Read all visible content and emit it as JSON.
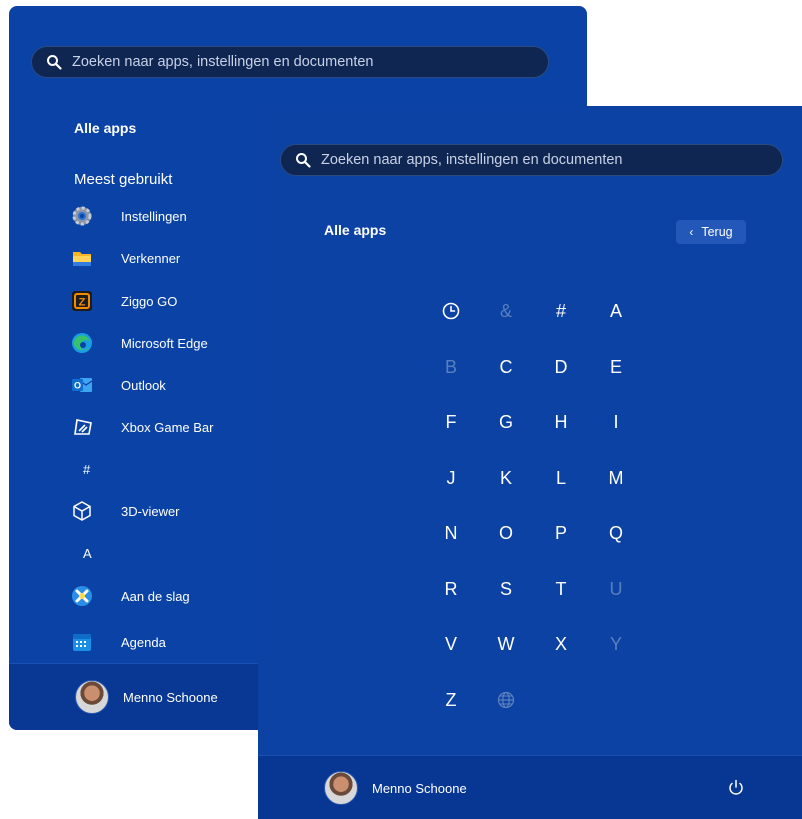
{
  "back_panel": {
    "search_placeholder": "Zoeken naar apps, instellingen en documenten",
    "title": "Alle apps",
    "most_used_title": "Meest gebruikt",
    "apps": [
      {
        "label": "Instellingen",
        "icon": "gear-icon"
      },
      {
        "label": "Verkenner",
        "icon": "folder-icon"
      },
      {
        "label": "Ziggo GO",
        "icon": "ziggo-icon"
      },
      {
        "label": "Microsoft Edge",
        "icon": "edge-icon"
      },
      {
        "label": "Outlook",
        "icon": "outlook-icon"
      },
      {
        "label": "Xbox Game Bar",
        "icon": "xbox-game-bar-icon"
      }
    ],
    "hash_header": "#",
    "apps_hash": [
      {
        "label": "3D-viewer",
        "icon": "cube-icon"
      }
    ],
    "a_header": "A",
    "apps_a": [
      {
        "label": "Aan de slag",
        "icon": "getting-started-icon"
      },
      {
        "label": "Agenda",
        "icon": "calendar-icon"
      }
    ],
    "user_name": "Menno Schoone"
  },
  "front_panel": {
    "search_placeholder": "Zoeken naar apps, instellingen en documenten",
    "title": "Alle apps",
    "back_label": "Terug",
    "letters": [
      {
        "label": "clock",
        "enabled": true,
        "icon": "clock-icon"
      },
      {
        "label": "&",
        "enabled": false
      },
      {
        "label": "#",
        "enabled": true
      },
      {
        "label": "A",
        "enabled": true
      },
      {
        "label": "B",
        "enabled": false
      },
      {
        "label": "C",
        "enabled": true
      },
      {
        "label": "D",
        "enabled": true
      },
      {
        "label": "E",
        "enabled": true
      },
      {
        "label": "F",
        "enabled": true
      },
      {
        "label": "G",
        "enabled": true
      },
      {
        "label": "H",
        "enabled": true
      },
      {
        "label": "I",
        "enabled": true
      },
      {
        "label": "J",
        "enabled": true
      },
      {
        "label": "K",
        "enabled": true
      },
      {
        "label": "L",
        "enabled": true
      },
      {
        "label": "M",
        "enabled": true
      },
      {
        "label": "N",
        "enabled": true
      },
      {
        "label": "O",
        "enabled": true
      },
      {
        "label": "P",
        "enabled": true
      },
      {
        "label": "Q",
        "enabled": true
      },
      {
        "label": "R",
        "enabled": true
      },
      {
        "label": "S",
        "enabled": true
      },
      {
        "label": "T",
        "enabled": true
      },
      {
        "label": "U",
        "enabled": false
      },
      {
        "label": "V",
        "enabled": true
      },
      {
        "label": "W",
        "enabled": true
      },
      {
        "label": "X",
        "enabled": true
      },
      {
        "label": "Y",
        "enabled": false
      },
      {
        "label": "Z",
        "enabled": true
      },
      {
        "label": "globe",
        "enabled": false,
        "icon": "globe-icon"
      }
    ],
    "user_name": "Menno Schoone",
    "power_icon": "power-icon"
  },
  "colors": {
    "panel_bg": "#0a43a5",
    "footer_bg": "#083794",
    "search_bg": "#0f2552",
    "disabled_letter": "#5a7fbf",
    "back_button_bg": "#2458b8"
  }
}
